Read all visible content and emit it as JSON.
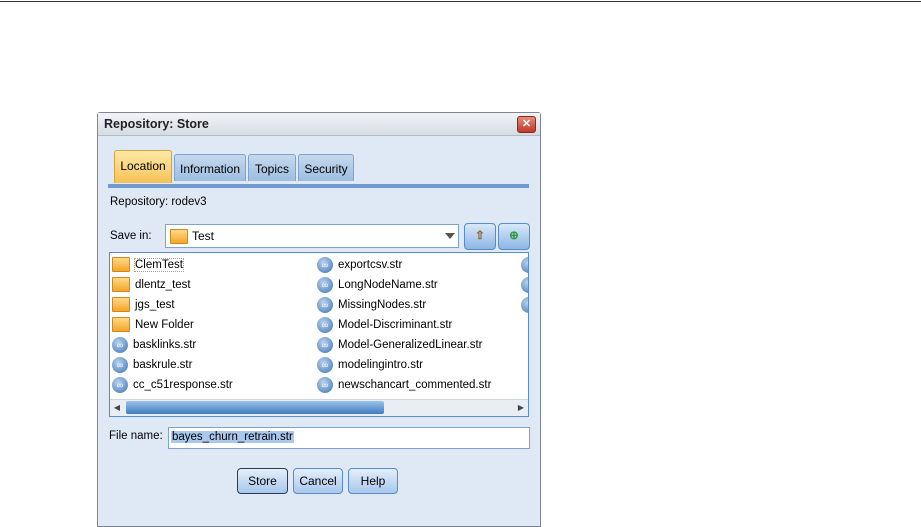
{
  "dialog": {
    "title": "Repository: Store",
    "close": "✕"
  },
  "tabs": [
    {
      "label": "Location"
    },
    {
      "label": "Information"
    },
    {
      "label": "Topics"
    },
    {
      "label": "Security"
    }
  ],
  "repository_label": "Repository: rodev3",
  "save_in": {
    "label": "Save in:",
    "value": "Test"
  },
  "files": [
    {
      "name": "ClemTest",
      "type": "folder"
    },
    {
      "name": "dlentz_test",
      "type": "folder"
    },
    {
      "name": "jgs_test",
      "type": "folder"
    },
    {
      "name": "New Folder",
      "type": "folder"
    },
    {
      "name": "basklinks.str",
      "type": "stream"
    },
    {
      "name": "baskrule.str",
      "type": "stream"
    },
    {
      "name": "cc_c51response.str",
      "type": "stream"
    },
    {
      "name": "exportcsv.str",
      "type": "stream"
    },
    {
      "name": "LongNodeName.str",
      "type": "stream"
    },
    {
      "name": "MissingNodes.str",
      "type": "stream"
    },
    {
      "name": "Model-Discriminant.str",
      "type": "stream"
    },
    {
      "name": "Model-GeneralizedLinear.str",
      "type": "stream"
    },
    {
      "name": "modelingintro.str",
      "type": "stream"
    },
    {
      "name": "newschancart_commented.str",
      "type": "stream"
    }
  ],
  "file_name": {
    "label": "File name:",
    "value": "bayes_churn_retrain.str"
  },
  "buttons": {
    "store": "Store",
    "cancel": "Cancel",
    "help": "Help"
  }
}
